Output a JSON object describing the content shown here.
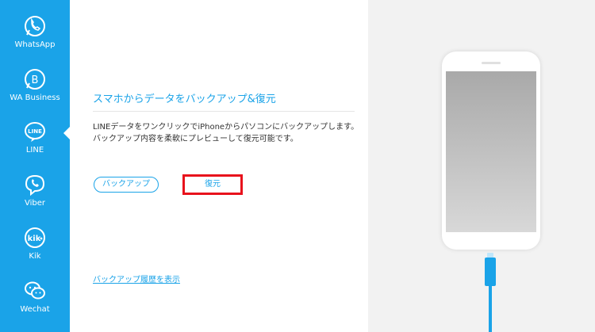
{
  "sidebar": {
    "items": [
      {
        "label": "WhatsApp",
        "icon": "whatsapp-icon"
      },
      {
        "label": "WA Business",
        "icon": "wa-business-icon"
      },
      {
        "label": "LINE",
        "icon": "line-icon",
        "active": true
      },
      {
        "label": "Viber",
        "icon": "viber-icon"
      },
      {
        "label": "Kik",
        "icon": "kik-icon"
      },
      {
        "label": "Wechat",
        "icon": "wechat-icon"
      }
    ]
  },
  "main": {
    "title": "スマホからデータをバックアップ&復元",
    "description_line1": "LINEデータをワンクリックでiPhoneからパソコンにバックアップします。",
    "description_line2": "バックアップ内容を柔軟にプレビューして復元可能です。",
    "backup_button": "バックアップ",
    "restore_button": "復元",
    "history_link": "バックアップ履歴を表示"
  },
  "colors": {
    "accent": "#1aa3e8",
    "highlight": "#e8121c",
    "right_panel_bg": "#f2f2f2"
  }
}
